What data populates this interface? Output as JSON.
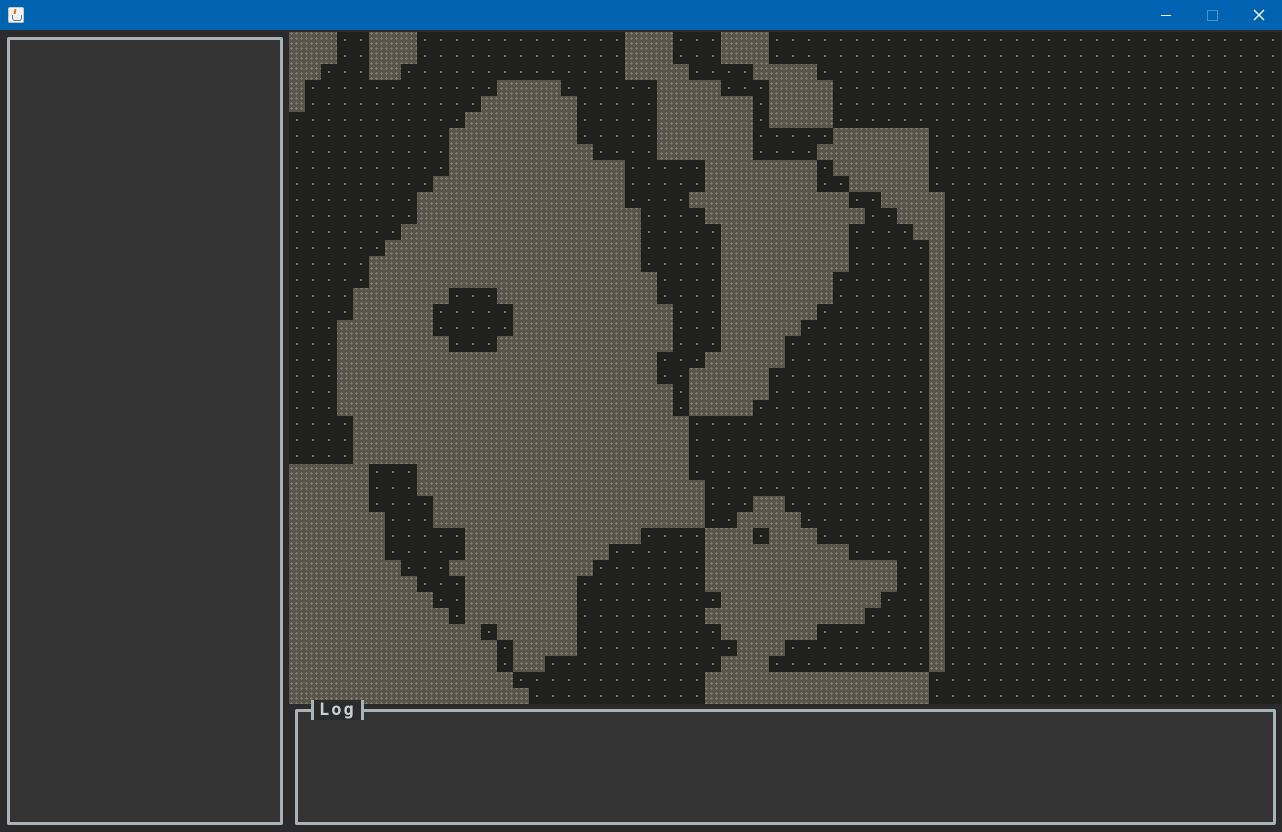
{
  "window": {
    "controls": {
      "minimize": "minimize",
      "maximize": "maximize",
      "close": "close"
    },
    "app_icon": "java-cup-icon"
  },
  "log": {
    "title": "Log"
  },
  "map": {
    "tile_size": 16,
    "legend": {
      "#": "floor",
      ".": "wall"
    },
    "colors": {
      "floor": "#5a554a",
      "floor_pattern": "#7e776b",
      "wall": "#20211d",
      "wall_dot": "#667071"
    },
    "rows": [
      "###..###.............###...###.........",
      "###..###.............###...###.........",
      "##...##..............####....####......",
      "#............####......####...####.....",
      "#...........######.....######.####.....",
      "...........#######.....######.####.....",
      "..........########.....######.....######",
      "..........#########....######....#######",
      "..........###########.....#######.######",
      ".........############.....#######..#####",
      "........#############....##########..####",
      "........##############....##########..###",
      ".......###############.....########....##",
      "......################.....########.....#",
      ".....#################.....########.....#",
      ".....##################....#######......#",
      "....######...##########....#######......#",
      "....#####.....##########...######.......#",
      "...######.....##########...#####........#",
      "...#######...###########...####.........#",
      "...####################...#####.........#",
      "...####################..#####..........#",
      "...#####################.#####..........#",
      "...#####################.####...........#",
      "....#####################...............#",
      "....#####################...............#",
      "....#####################...............#",
      "#####...#################...............#",
      "#####...##################..............#",
      "#####....#################...##.........#",
      "######...#################..####........#",
      "######.....###########....###.###.......#",
      "######.....#########......#########.....#",
      "#######...#########.......############..#",
      "########...#######........############..#",
      "#########..#######.........##########...#",
      "##########.#######........##########....#",
      "############.#####.........######.......#",
      "#############.####..........###.........#",
      "#############.##...........###..........#",
      "##############............##############.",
      "###############...........##############."
    ]
  }
}
